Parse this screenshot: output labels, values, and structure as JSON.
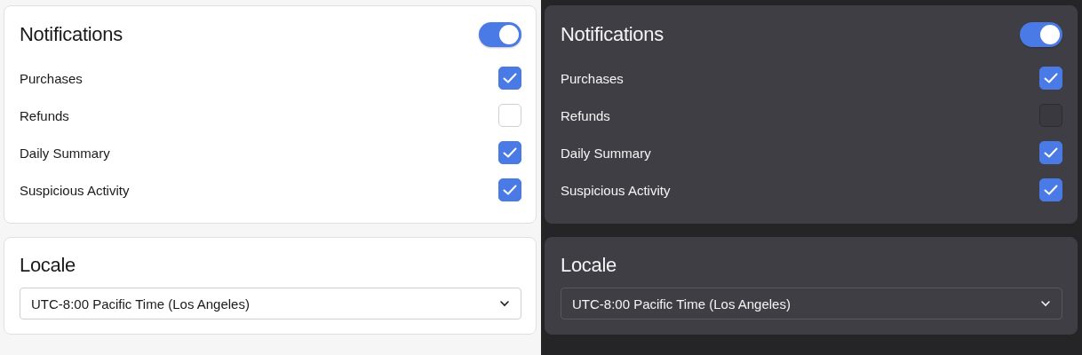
{
  "panels": [
    {
      "kind": "light",
      "notifications": {
        "title": "Notifications",
        "on": true,
        "items": [
          {
            "label": "Purchases",
            "checked": true
          },
          {
            "label": "Refunds",
            "checked": false
          },
          {
            "label": "Daily Summary",
            "checked": true
          },
          {
            "label": "Suspicious Activity",
            "checked": true
          }
        ]
      },
      "locale": {
        "title": "Locale",
        "value": "UTC-8:00 Pacific Time (Los Angeles)"
      }
    },
    {
      "kind": "dark",
      "notifications": {
        "title": "Notifications",
        "on": true,
        "items": [
          {
            "label": "Purchases",
            "checked": true
          },
          {
            "label": "Refunds",
            "checked": false
          },
          {
            "label": "Daily Summary",
            "checked": true
          },
          {
            "label": "Suspicious Activity",
            "checked": true
          }
        ]
      },
      "locale": {
        "title": "Locale",
        "value": "UTC-8:00 Pacific Time (Los Angeles)"
      }
    }
  ]
}
